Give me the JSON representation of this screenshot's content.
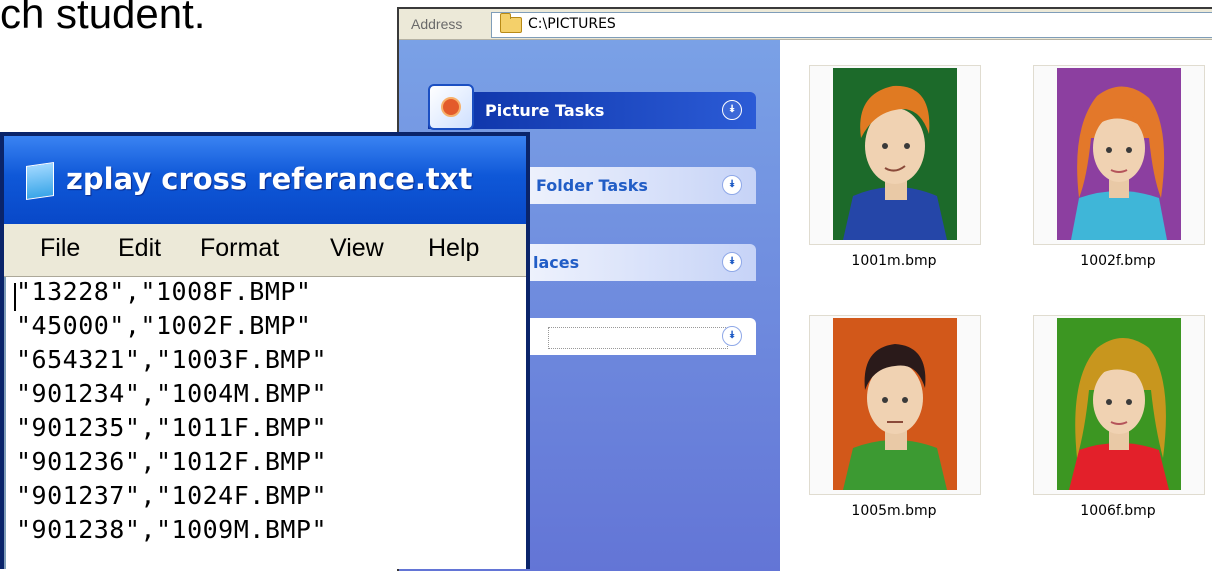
{
  "slide": {
    "visible_text": "ch student."
  },
  "explorer": {
    "address_label": "Address",
    "address_value": "C:\\PICTURES",
    "tasks": [
      {
        "label": "Picture Tasks"
      },
      {
        "label": "Folder Tasks"
      },
      {
        "label": "laces"
      }
    ],
    "thumbnails": [
      {
        "filename": "1001m.bmp",
        "bg": "#1c6a2a",
        "hair": "#e07a22",
        "shirt": "#2546a8"
      },
      {
        "filename": "1002f.bmp",
        "bg": "#8c3fa0",
        "hair": "#e3782a",
        "shirt": "#3fb6d8"
      },
      {
        "filename": "1005m.bmp",
        "bg": "#d2581a",
        "hair": "#2a1a1a",
        "shirt": "#3c9a32"
      },
      {
        "filename": "1006f.bmp",
        "bg": "#3c9622",
        "hair": "#c8961e",
        "shirt": "#e3202a"
      }
    ]
  },
  "notepad": {
    "title": "zplay cross referance.txt",
    "menu": [
      "File",
      "Edit",
      "Format",
      "View",
      "Help"
    ],
    "lines": [
      "\"13228\",\"1008F.BMP\"",
      "\"45000\",\"1002F.BMP\"",
      "\"654321\",\"1003F.BMP\"",
      "\"901234\",\"1004M.BMP\"",
      "\"901235\",\"1011F.BMP\"",
      "\"901236\",\"1012F.BMP\"",
      "\"901237\",\"1024F.BMP\"",
      "\"901238\",\"1009M.BMP\""
    ]
  }
}
